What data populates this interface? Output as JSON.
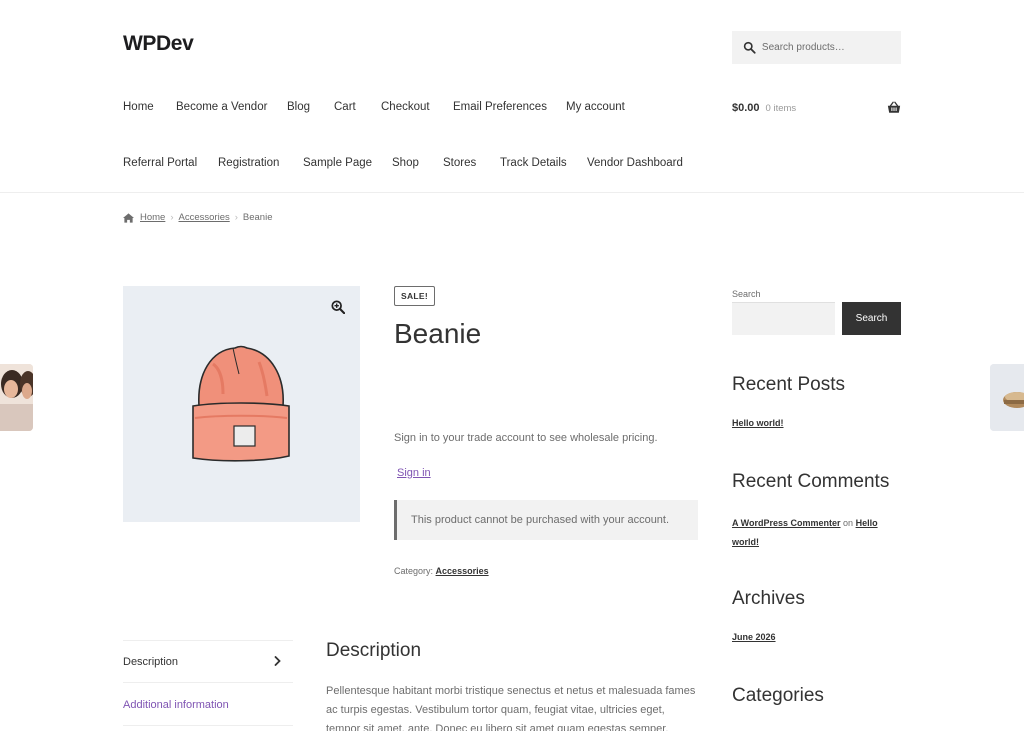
{
  "site": {
    "title": "WPDev"
  },
  "header_search": {
    "placeholder": "Search products…"
  },
  "nav": {
    "items": [
      "Home",
      "Become a Vendor",
      "Blog",
      "Cart",
      "Checkout",
      "Email Preferences",
      "My account",
      "Referral Portal",
      "Registration",
      "Sample Page",
      "Shop",
      "Stores",
      "Track Details",
      "Vendor Dashboard"
    ]
  },
  "cart": {
    "amount": "$0.00",
    "count": "0 items"
  },
  "breadcrumb": {
    "home": "Home",
    "category": "Accessories",
    "current": "Beanie"
  },
  "product": {
    "badge": "SALE!",
    "title": "Beanie",
    "wholesale_text": "Sign in to your trade account to see wholesale pricing.",
    "sign_in": "Sign in",
    "notice": "This product cannot be purchased with your account.",
    "category_label": "Category:",
    "category": "Accessories"
  },
  "sidebar": {
    "search_label": "Search",
    "search_button": "Search",
    "recent_posts_heading": "Recent Posts",
    "recent_post": "Hello world!",
    "recent_comments_heading": "Recent Comments",
    "comment_author": "A WordPress Commenter",
    "comment_on": "on",
    "comment_post": "Hello world!",
    "archives_heading": "Archives",
    "archive_item": "June 2026",
    "categories_heading": "Categories"
  },
  "tabs": [
    {
      "label": "Description"
    },
    {
      "label": "Additional information"
    }
  ],
  "description": {
    "heading": "Description",
    "body": "Pellentesque habitant morbi tristique senectus et netus et malesuada fames ac turpis egestas. Vestibulum tortor quam, feugiat vitae, ultricies eget, tempor sit amet, ante. Donec eu libero sit amet quam egestas semper."
  },
  "colors": {
    "accent_purple": "#7f54b3",
    "dark_button": "#333333",
    "image_bg": "#eaeef3",
    "beanie": "#f0907a"
  }
}
